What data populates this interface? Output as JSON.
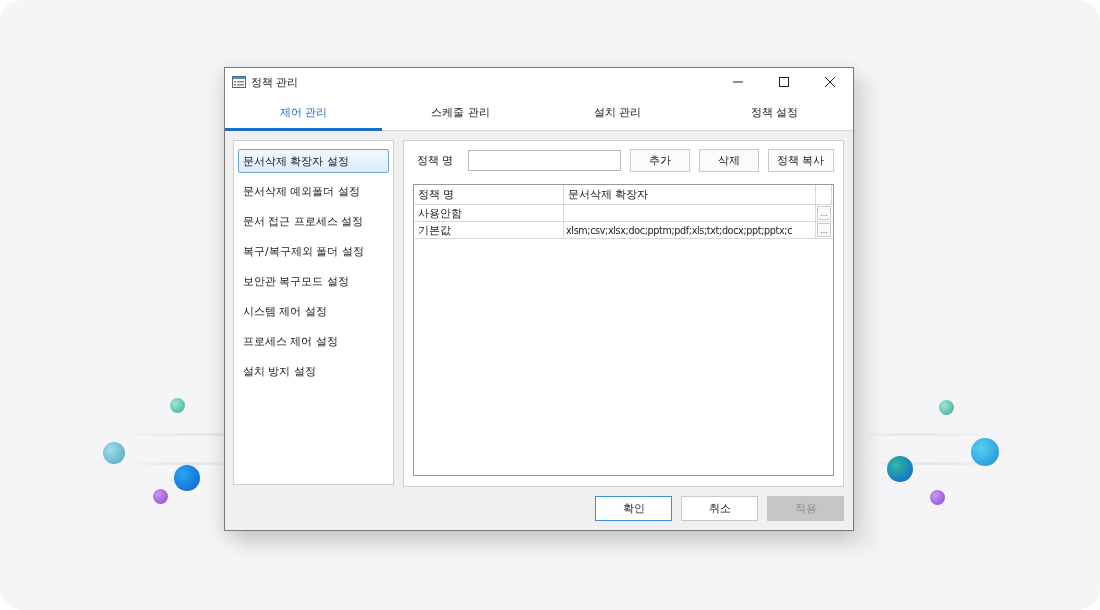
{
  "window": {
    "title": "정책 관리"
  },
  "tabs": [
    {
      "label": "제어 관리",
      "selected": true
    },
    {
      "label": "스케줄 관리",
      "selected": false
    },
    {
      "label": "설치 관리",
      "selected": false
    },
    {
      "label": "정책 설정",
      "selected": false
    }
  ],
  "sidebar": {
    "items": [
      {
        "label": "문서삭제 확장자 설정",
        "selected": true
      },
      {
        "label": "문서삭제 예외폴더 설정",
        "selected": false
      },
      {
        "label": "문서 접근 프로세스 설정",
        "selected": false
      },
      {
        "label": "복구/복구제외 폴더 설정",
        "selected": false
      },
      {
        "label": "보안관 복구모드 설정",
        "selected": false
      },
      {
        "label": "시스템 제어 설정",
        "selected": false
      },
      {
        "label": "프로세스 제어 설정",
        "selected": false
      },
      {
        "label": "설치 방지 설정",
        "selected": false
      }
    ]
  },
  "policy_form": {
    "label": "정책 명",
    "buttons": [
      "추가",
      "삭제",
      "정책 복사"
    ]
  },
  "table": {
    "columns": [
      "정책 명",
      "문서삭제 확장자"
    ],
    "rows": [
      {
        "cells": [
          "사용안함",
          ""
        ],
        "button": "..."
      },
      {
        "cells": [
          "기본값",
          "xlsm;csv;xlsx;doc;pptm;pdf;xls;txt;docx;ppt;pptx;c"
        ],
        "button": "..."
      }
    ]
  },
  "footer_buttons": [
    {
      "label": "확인",
      "kind": "default",
      "disabled": false
    },
    {
      "label": "취소",
      "kind": "normal",
      "disabled": false
    },
    {
      "label": "적용",
      "kind": "normal",
      "disabled": true
    }
  ]
}
